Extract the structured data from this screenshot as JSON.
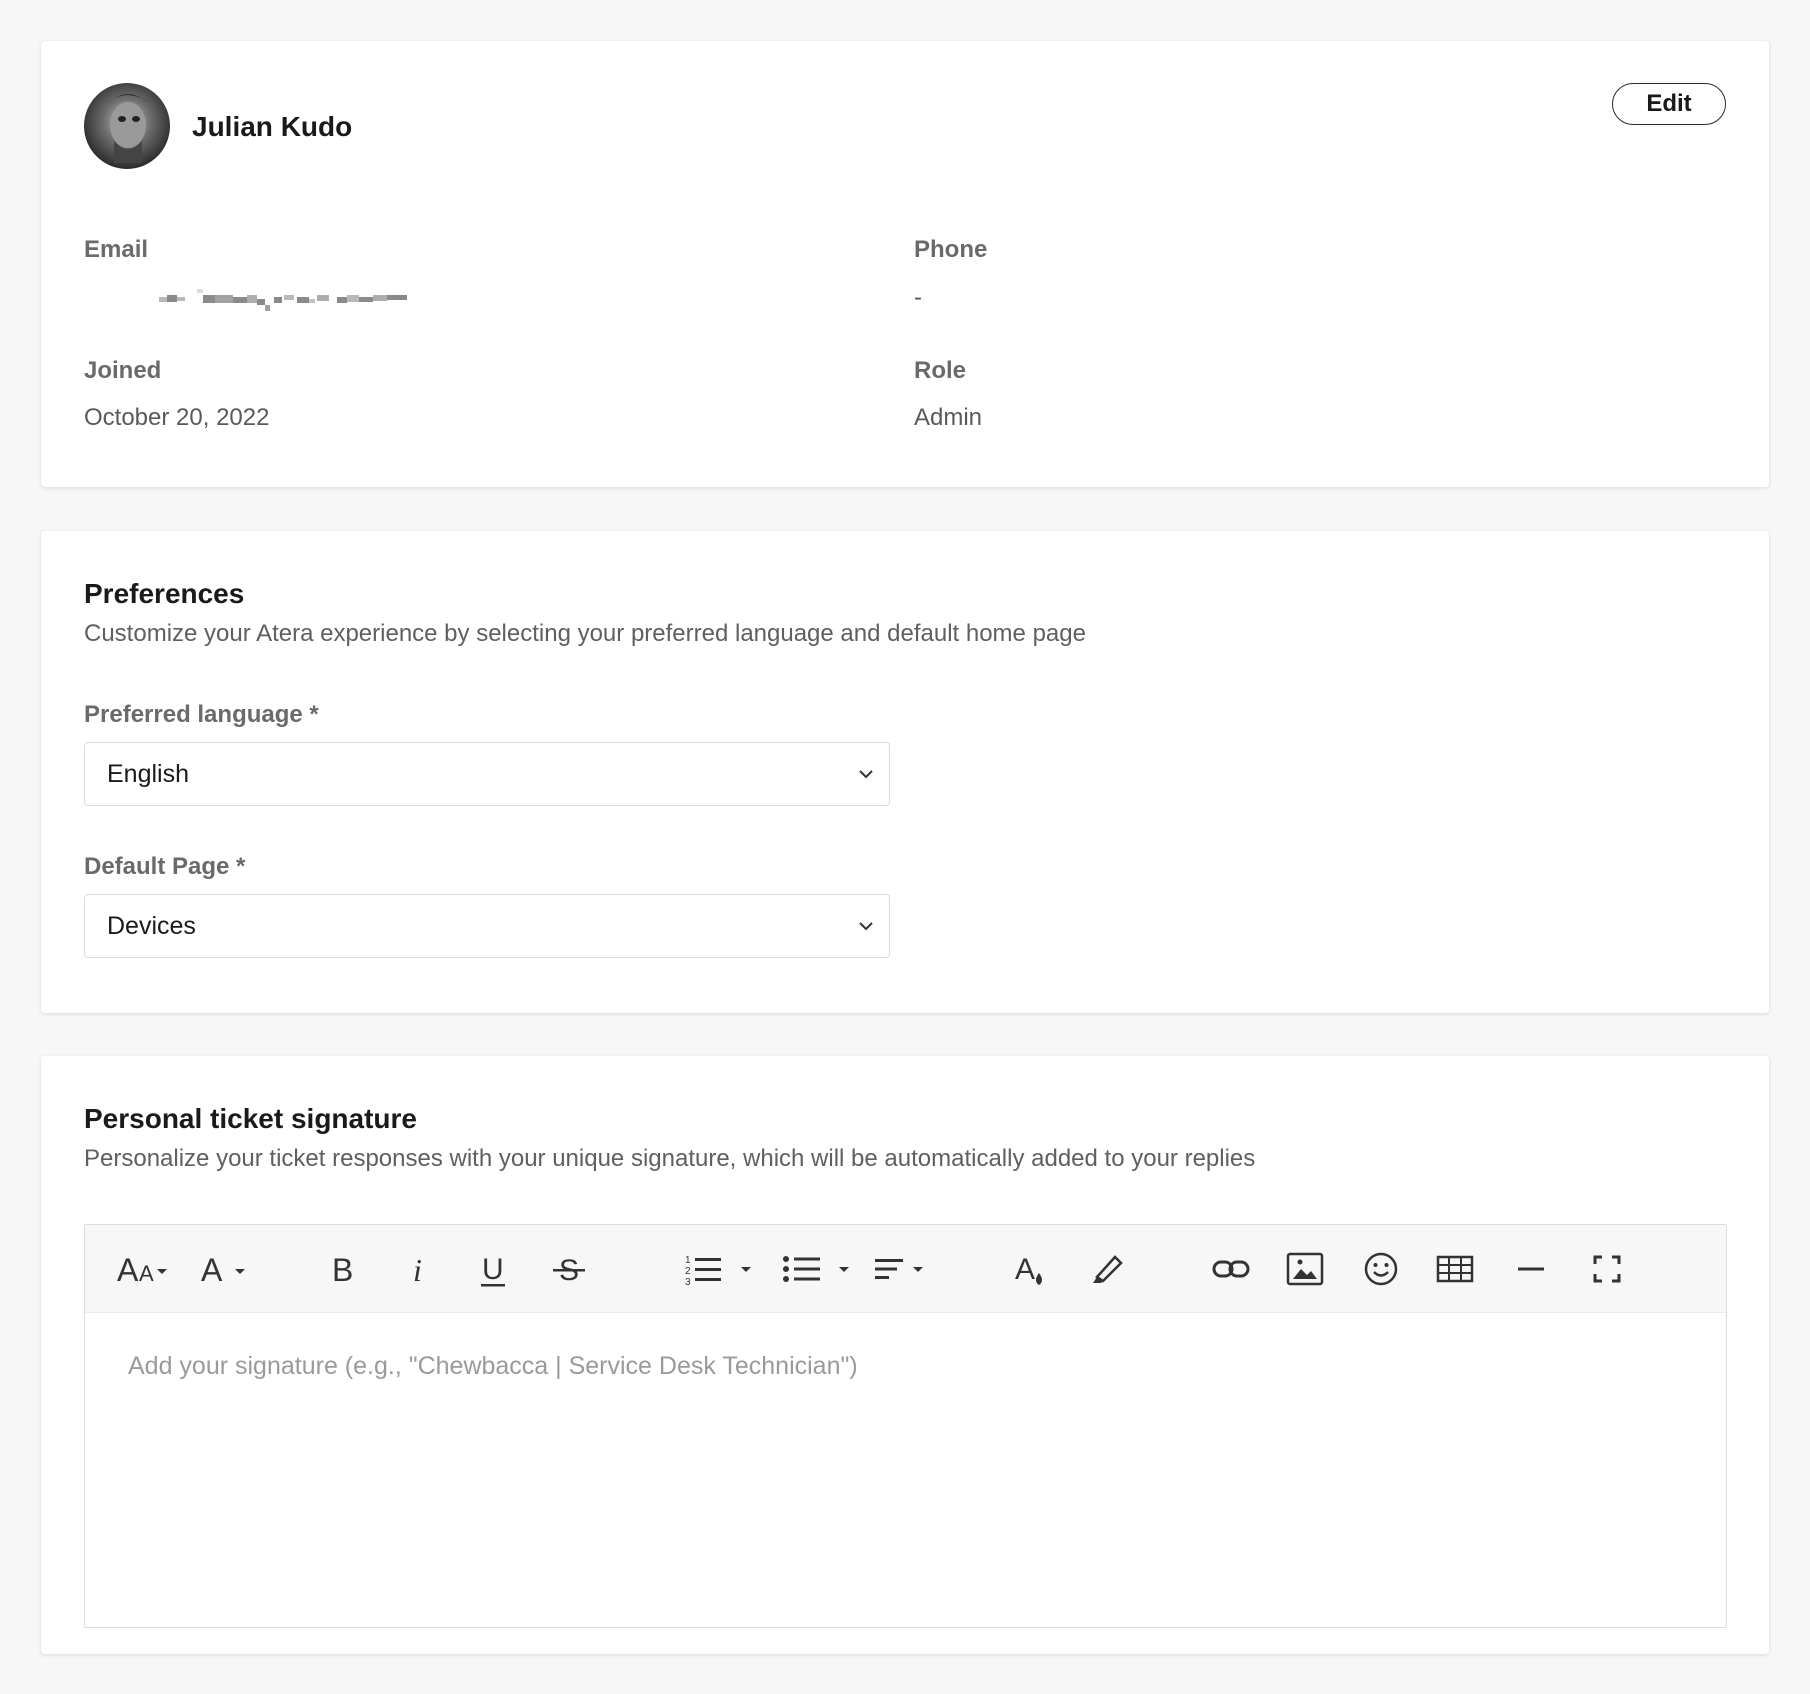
{
  "profile": {
    "name": "Julian Kudo",
    "edit_label": "Edit",
    "email_label": "Email",
    "phone_label": "Phone",
    "phone_value": "-",
    "joined_label": "Joined",
    "joined_value": "October 20, 2022",
    "role_label": "Role",
    "role_value": "Admin"
  },
  "preferences": {
    "title": "Preferences",
    "description": "Customize your Atera experience by selecting your preferred language and default home page",
    "language_label": "Preferred language *",
    "language_value": "English",
    "default_page_label": "Default Page *",
    "default_page_value": "Devices"
  },
  "signature": {
    "title": "Personal ticket signature",
    "description": "Personalize your ticket responses with your unique signature, which will be automatically added to your replies",
    "placeholder": "Add your signature (e.g., \"Chewbacca | Service Desk Technician\")",
    "toolbar_icons": [
      "font-size-icon",
      "font-family-icon",
      "bold-icon",
      "italic-icon",
      "underline-icon",
      "strikethrough-icon",
      "ordered-list-icon",
      "unordered-list-icon",
      "align-icon",
      "text-color-icon",
      "highlight-icon",
      "link-icon",
      "image-icon",
      "emoji-icon",
      "table-icon",
      "horizontal-line-icon",
      "fullscreen-icon"
    ]
  }
}
